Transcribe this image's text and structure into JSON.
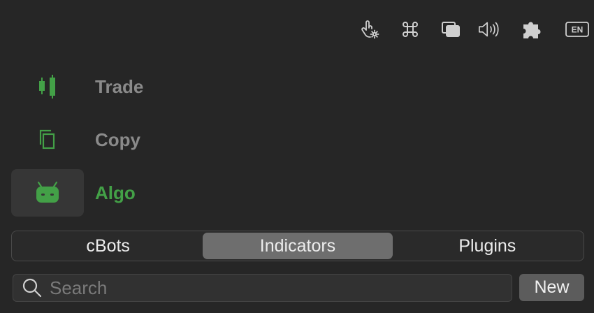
{
  "toolbar": {
    "icons": [
      "touch-settings-icon",
      "command-icon",
      "windows-icon",
      "speaker-icon",
      "puzzle-icon",
      "language-icon"
    ],
    "language": "EN"
  },
  "nav": {
    "items": [
      {
        "label": "Trade",
        "icon": "candlestick-icon",
        "active": false
      },
      {
        "label": "Copy",
        "icon": "copy-icon",
        "active": false
      },
      {
        "label": "Algo",
        "icon": "robot-icon",
        "active": true
      }
    ]
  },
  "tabs": {
    "items": [
      {
        "label": "cBots",
        "active": false
      },
      {
        "label": "Indicators",
        "active": true
      },
      {
        "label": "Plugins",
        "active": false
      }
    ]
  },
  "search": {
    "placeholder": "Search",
    "value": ""
  },
  "new_button": {
    "label": "New"
  },
  "colors": {
    "accent": "#43a047",
    "background": "#262626"
  }
}
